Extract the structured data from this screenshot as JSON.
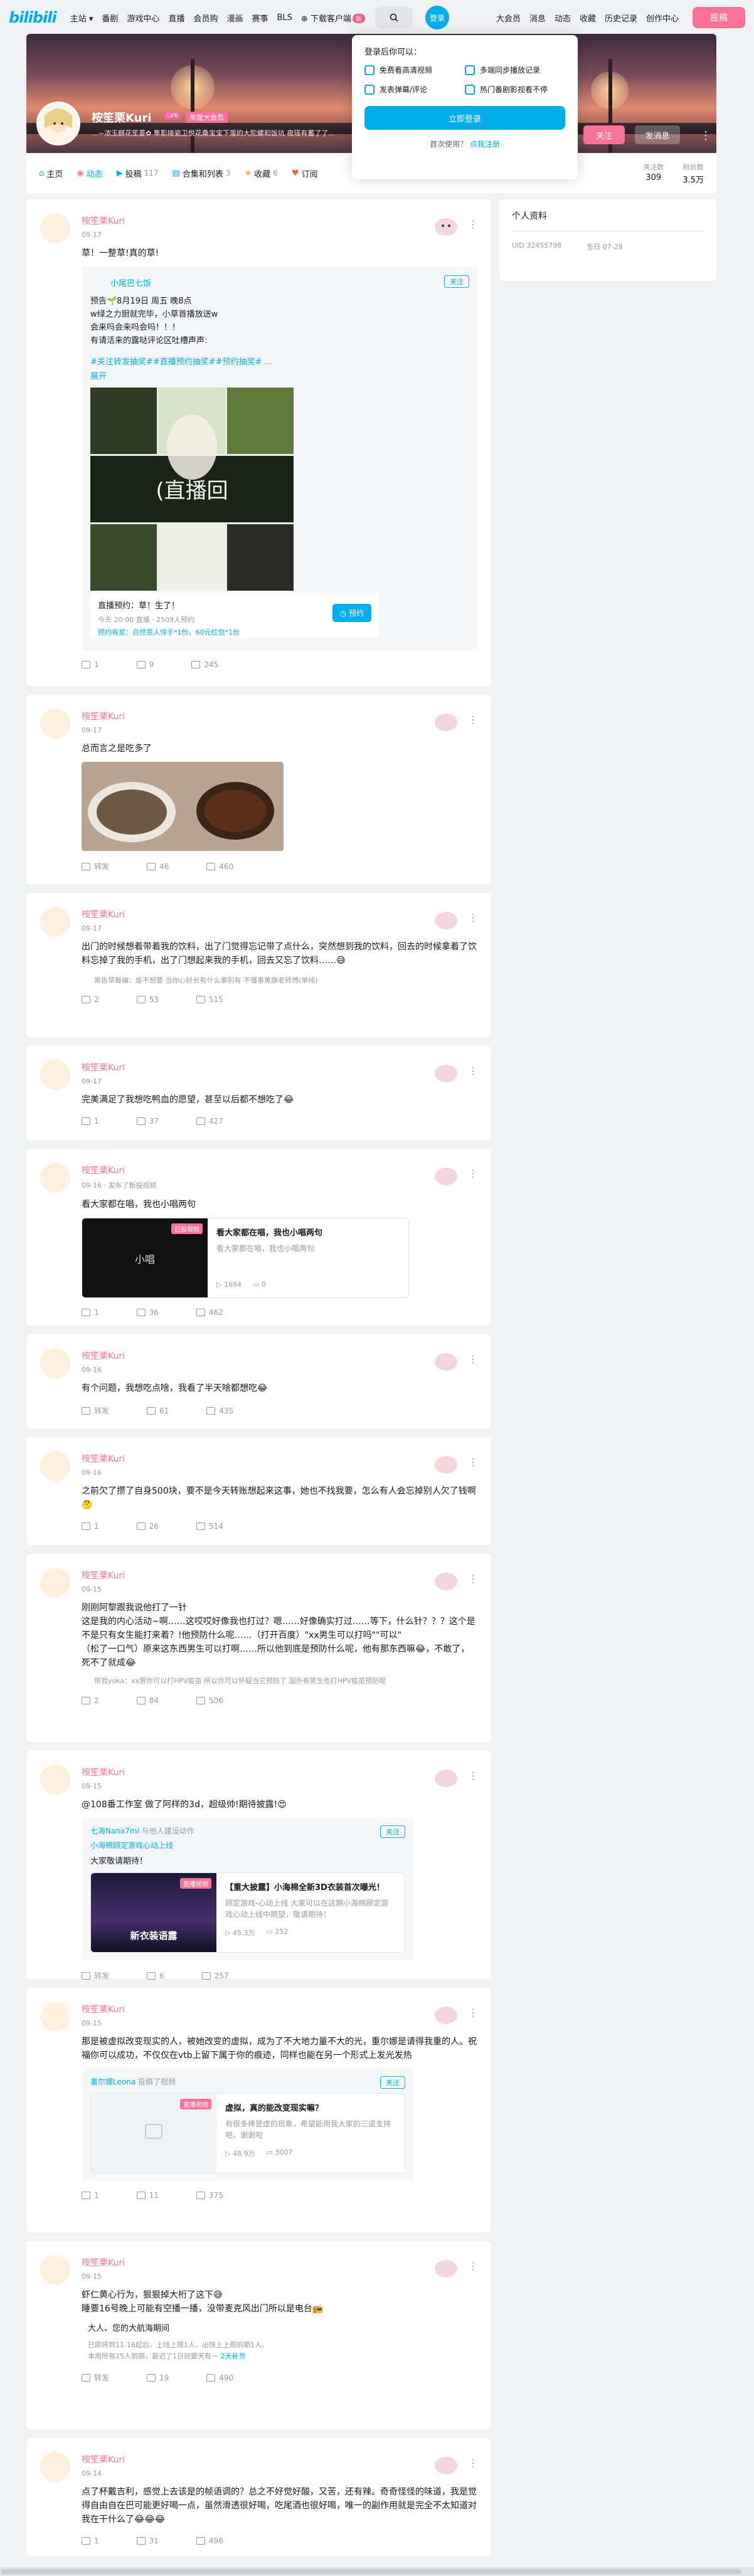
{
  "nav": {
    "logo": "bilibili",
    "left": [
      "主站",
      "番剧",
      "游戏中心",
      "直播",
      "会员购",
      "漫画",
      "赛事",
      "BLS"
    ],
    "download": "下载客户端",
    "download_badge": "新",
    "login": "登录",
    "right": [
      "大会员",
      "消息",
      "动态",
      "收藏",
      "历史记录",
      "创作中心"
    ],
    "upload": "投稿"
  },
  "popup": {
    "title": "登录后你可以：",
    "benefits": [
      "免费看高清视频",
      "多端同步播放记录",
      "发表弹幕/评论",
      "热门番剧影视看不停"
    ],
    "login_now": "立即登录",
    "first_time": "首次使用？",
    "register": "点我注册"
  },
  "profile": {
    "name": "桉笙栗Kuri",
    "level": "LV6",
    "vip": "年度大会员",
    "sign": "…~浓玉麒花笙菱✿ 隼影接瓷卫悦花桑宝宝下蛋的大陀螺和饭坑 夜瑶有蓄了了...",
    "follow": "关注",
    "message": "发消息",
    "more": "⋮",
    "tabs": [
      {
        "label": "主页",
        "count": ""
      },
      {
        "label": "动态",
        "count": ""
      },
      {
        "label": "投稿",
        "count": "117"
      },
      {
        "label": "合集和列表",
        "count": "3"
      },
      {
        "label": "收藏",
        "count": "6"
      },
      {
        "label": "订阅",
        "count": ""
      }
    ],
    "stats": [
      {
        "label": "关注数",
        "value": "309"
      },
      {
        "label": "粉丝数",
        "value": "3.5万"
      }
    ]
  },
  "side": {
    "title": "个人资料",
    "uid_label": "UID",
    "uid": "32455798",
    "birthday_label": "生日",
    "birthday": "07-28"
  },
  "posts": [
    {
      "name": "桉笙栗Kuri",
      "time": "09-17",
      "text": "草！一整草!真的草!",
      "forward": {
        "author": "小尾巴七饭",
        "follow": "关注",
        "lines": [
          "预告🌱8月19日 周五 晚8点",
          "w绿之力厨就完毕，小草首播放送w",
          "会来吗会来吗会吗！！！",
          "有请活来的露哒评论区吐槽声声:"
        ],
        "tags": "#关注转发抽奖##直播预约抽奖##预约抽奖# ...",
        "expand": "展开",
        "live_title": "直播预约：草！生了！",
        "live_meta": "今天 20:00 直播 · 2509人预约",
        "live_prize": "预约有奖：自然恩人惊手*1份，60元红包*1份",
        "live_btn": "预约"
      },
      "stats": {
        "share": "1",
        "comment": "9",
        "like": "245"
      }
    },
    {
      "name": "桉笙栗Kuri",
      "time": "09-17",
      "text": "总而言之是吃多了",
      "stats": {
        "share": "转发",
        "comment": "46",
        "like": "460"
      }
    },
    {
      "name": "桉笙栗Kuri",
      "time": "09-17",
      "text": "出门的时候想着带着我的饮料，出了门觉得忘记带了点什么，突然想到我的饮料，回去的时候拿着了饮料忘掉了我的手机，出了门想起来我的手机，回去又忘了饮料……😅",
      "quote": "黑告草每编：废不想要 当你心好长有什么事别有 不懂事黄旗老师傅(单纯)",
      "stats": {
        "share": "2",
        "comment": "53",
        "like": "515"
      }
    },
    {
      "name": "桉笙栗Kuri",
      "time": "09-17",
      "text": "完美满足了我想吃鸭血的愿望，甚至以后都不想吃了😂",
      "stats": {
        "share": "1",
        "comment": "37",
        "like": "427"
      }
    },
    {
      "name": "桉笙栗Kuri",
      "time": "09-16 · 发布了新投视频",
      "text": "看大家都在唱，我也小唱两句",
      "video": {
        "title": "看大家都在唱，我也小唱两句",
        "desc": "看大家都在唱，我也小唱两句",
        "views": "1694",
        "danmaku": "0",
        "tag": "已投视频",
        "thumb": "小唱"
      },
      "stats": {
        "share": "1",
        "comment": "36",
        "like": "462"
      }
    },
    {
      "name": "桉笙栗Kuri",
      "time": "09-16",
      "text": "有个问题，我想吃点啥，我看了半天啥都想吃😂",
      "stats": {
        "share": "转发",
        "comment": "61",
        "like": "435"
      }
    },
    {
      "name": "桉笙栗Kuri",
      "time": "09-16",
      "text": "之前欠了攒了自身500块，要不是今天转账想起来这事，她也不找我要，怎么有人会忘掉别人欠了钱啊🤔",
      "stats": {
        "share": "1",
        "comment": "26",
        "like": "514"
      }
    },
    {
      "name": "桉笙栗Kuri",
      "time": "09-15",
      "text": "刚刚阿黎跟我说他打了一针\n这是我的内心活动~啊……这哎哎好像我也打过？嗯……好像确实打过……等下，什么针？？？这个是不是只有女生能打来着？!他预防什么呢……（打开百度）\"xx男生可以打吗\"\"可以\"\n（松了一口气）原来这东西男生可以打啊……所以他到底是预防什么呢，他有那东西嘛😂，不敢了，死不了就成😂",
      "quote": "带我yoka：xx男你可以打HPV疫苗 所以你可以怀疑当它预防了 国外有男生也打HPV疫苗预防呢",
      "stats": {
        "share": "2",
        "comment": "84",
        "like": "506"
      }
    },
    {
      "name": "桉笙栗Kuri",
      "time": "09-15",
      "text": "@108番工作室 做了阿样的3d，超级帅!期待披露!😍",
      "forward": {
        "author": "七海Nana7mi",
        "note": "与他人建设动作",
        "sub": "小海棉顾定游戏心动上线",
        "line": "大家敬请期待！",
        "follow": "关注",
        "video": {
          "title": "【重大披露】小海棉全新3D衣装首次曝光！",
          "desc": "顾定游戏-心动上线 大家可以在这期小海棉顾定游戏心动上线中期望，敬请期待！",
          "views": "45.3万",
          "danmaku": "252",
          "tag": "直播视频",
          "thumb": "新衣装语露"
        }
      },
      "stats": {
        "share": "转发",
        "comment": "6",
        "like": "257"
      }
    },
    {
      "name": "桉笙栗Kuri",
      "time": "09-15",
      "text": "那是被虚拟改变现实的人，被她改变的虚拟，成为了不大地力量不大的光，重尔娜是请得我重的人。祝福你可以成功，不仅仅在vtb上留下属于你的痕迹，同样也能在另一个形式上发光发热",
      "forward": {
        "author": "重尔娜Leona",
        "note": "投稿了视频",
        "follow": "关注",
        "video": {
          "title": "虚拟，真的能改变现实嘛？",
          "desc": "有很多棒是虚的现象，希望能用我大家的三道支持吧，谢谢啦",
          "views": "48.9万",
          "danmaku": "3007",
          "tag": "直播视频",
          "thumb": ""
        }
      },
      "stats": {
        "share": "1",
        "comment": "11",
        "like": "375"
      }
    },
    {
      "name": "桉笙栗Kuri",
      "time": "09-15",
      "text": "虾仁黄心行为，狠狠掉大桁了这下😅\n睡要16号晚上可能有空播一播，没带麦克风出门所以是电台📻",
      "note": {
        "h": "大人、您的大航海期间",
        "l1": "已即将到11-16起后，上线上限1人，出快上上周前期1人。",
        "l2": "本周所有25人到期，最迟了1日就要天有一",
        "more": "2天补货"
      },
      "stats": {
        "share": "转发",
        "comment": "19",
        "like": "490"
      }
    },
    {
      "name": "桉笙栗Kuri",
      "time": "09-14",
      "text": "点了杯戴吉利，感觉上去该是的帧语调的？总之不好觉好酸，又苦，还有辣。奇奇怪怪的味道，我是觉得自由自在巴可能更好喝一点，虽然滑透很好喝，吃尾酒也很好喝，唯一的副作用就是完全不太知道对我在干什么了😂😂😂",
      "stats": {
        "share": "1",
        "comment": "31",
        "like": "496"
      }
    }
  ],
  "colors": {
    "accent": "#00aeec",
    "pink": "#fb7299",
    "bg": "#f1f2f3"
  }
}
